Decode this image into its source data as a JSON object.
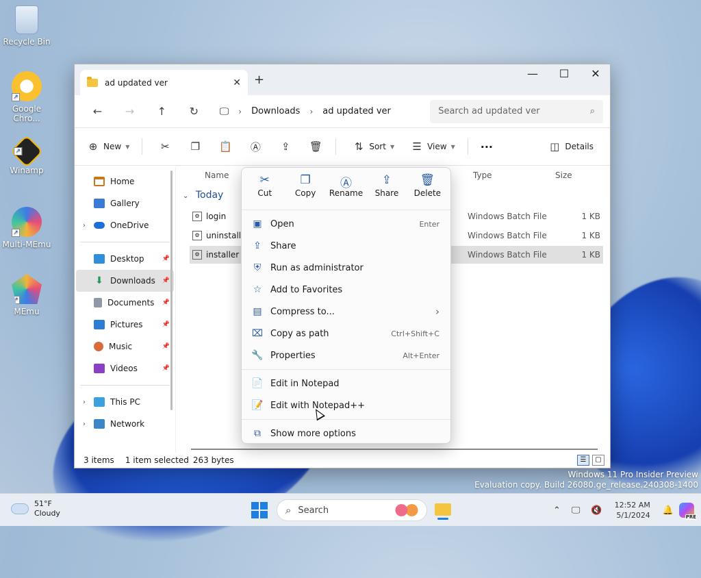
{
  "desktop": {
    "icons": [
      {
        "label": "Recycle Bin"
      },
      {
        "label": "Google Chro..."
      },
      {
        "label": "Winamp"
      },
      {
        "label": "Multi-MEmu"
      },
      {
        "label": "MEmu"
      }
    ]
  },
  "window": {
    "tab_title": "ad updated ver",
    "controls": {
      "minimize": "—",
      "maximize": "☐",
      "close": "✕"
    }
  },
  "nav": {
    "breadcrumb": [
      "Downloads",
      "ad updated ver"
    ],
    "search_placeholder": "Search ad updated ver"
  },
  "toolbar": {
    "new_label": "New",
    "sort_label": "Sort",
    "view_label": "View",
    "more_label": "···",
    "details_label": "Details"
  },
  "sidebar": {
    "items": [
      {
        "label": "Home"
      },
      {
        "label": "Gallery"
      },
      {
        "label": "OneDrive"
      },
      {
        "label": "Desktop"
      },
      {
        "label": "Downloads"
      },
      {
        "label": "Documents"
      },
      {
        "label": "Pictures"
      },
      {
        "label": "Music"
      },
      {
        "label": "Videos"
      },
      {
        "label": "This PC"
      },
      {
        "label": "Network"
      }
    ]
  },
  "columns": {
    "name": "Name",
    "type": "Type",
    "size": "Size"
  },
  "group_label": "Today",
  "files": [
    {
      "name": "login",
      "type": "Windows Batch File",
      "size": "1 KB"
    },
    {
      "name": "uninstall",
      "type": "Windows Batch File",
      "size": "1 KB"
    },
    {
      "name": "installer",
      "type": "Windows Batch File",
      "size": "1 KB"
    }
  ],
  "status": {
    "items": "3 items",
    "selected": "1 item selected",
    "bytes": "263 bytes"
  },
  "context_menu": {
    "quick": [
      {
        "label": "Cut"
      },
      {
        "label": "Copy"
      },
      {
        "label": "Rename"
      },
      {
        "label": "Share"
      },
      {
        "label": "Delete"
      }
    ],
    "items": [
      {
        "label": "Open",
        "shortcut": "Enter"
      },
      {
        "label": "Share",
        "shortcut": ""
      },
      {
        "label": "Run as administrator",
        "shortcut": ""
      },
      {
        "label": "Add to Favorites",
        "shortcut": ""
      },
      {
        "label": "Compress to...",
        "shortcut": "›"
      },
      {
        "label": "Copy as path",
        "shortcut": "Ctrl+Shift+C"
      },
      {
        "label": "Properties",
        "shortcut": "Alt+Enter"
      },
      {
        "label": "Edit in Notepad",
        "shortcut": ""
      },
      {
        "label": "Edit with Notepad++",
        "shortcut": ""
      },
      {
        "label": "Show more options",
        "shortcut": ""
      }
    ]
  },
  "watermark": {
    "line1": "Windows 11 Pro Insider Preview",
    "line2": "Evaluation copy. Build 26080.ge_release.240308-1400"
  },
  "taskbar": {
    "weather_temp": "51°F",
    "weather_desc": "Cloudy",
    "search_label": "Search",
    "time": "12:52 AM",
    "date": "5/1/2024",
    "copilot_badge": "PRE"
  }
}
